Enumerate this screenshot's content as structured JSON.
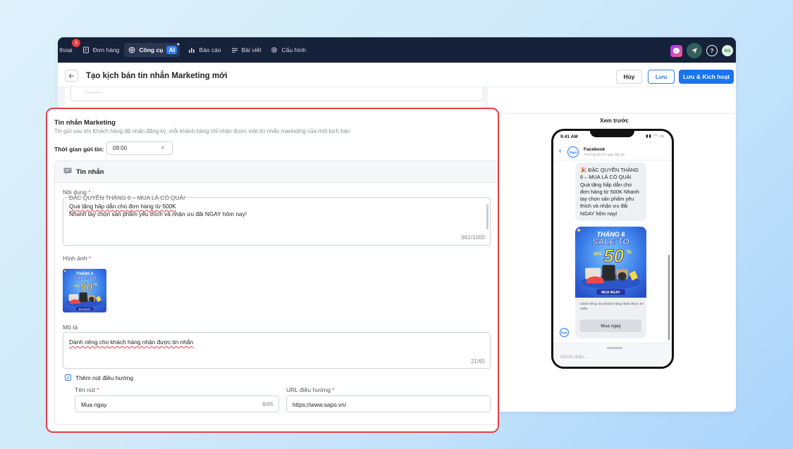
{
  "topbar": {
    "nav": [
      {
        "label": "i thoại",
        "icon": "chat-icon",
        "badge": "3"
      },
      {
        "label": "Đơn hàng",
        "icon": "order-icon"
      },
      {
        "label": "Công cụ",
        "icon": "tools-icon",
        "badge_label": "AI",
        "active": true
      },
      {
        "label": "Báo cáo",
        "icon": "chart-icon"
      },
      {
        "label": "Bài viết",
        "icon": "article-icon"
      },
      {
        "label": "Cấu hình",
        "icon": "gear-icon"
      }
    ],
    "avatar_initials": "NS"
  },
  "header": {
    "title": "Tạo kịch bản tin nhắn Marketing mới",
    "cancel_label": "Hủy",
    "save_label": "Lưu",
    "save_activate_label": "Lưu & Kích hoạt"
  },
  "top_card": {
    "dash": "------"
  },
  "section": {
    "title": "Tin nhắn Marketing",
    "description": "Tin gửi sau khi Khách hàng đã nhấn đăng ký, mỗi khách hàng chỉ nhận được một tin nhắn marketing của một kịch bản",
    "time_label": "Thời gian gửi tin:",
    "time_value": "09:00"
  },
  "message": {
    "header": "Tin nhắn",
    "content_label": "Nội dung",
    "content_lines": [
      "ĐẶC QUYỀN THÁNG 6 – MUA LÀ CÓ QUÀ!",
      "Quà tặng hấp dẫn cho đơn hàng từ 500K",
      "Nhanh tay chọn sản phẩm yêu thích và nhận ưu đãi NGAY hôm nay!"
    ],
    "content_counter": "861/1000",
    "image_label": "Hình ảnh",
    "desc_label": "Mô tả",
    "desc_value": "Dành riêng cho khách hàng nhận được tin nhắn",
    "desc_counter": "21/65",
    "nav_checkbox_label": "Thêm nút điều hướng",
    "button_name_label": "Tên nút",
    "button_name_value": "Mua ngay",
    "button_name_counter": "8/65",
    "url_label": "URL điều hướng",
    "url_value": "https://www.sapo.vn/"
  },
  "promo_image": {
    "line1": "THÁNG 6",
    "line2": "SALE TO",
    "prefix": "ĐẾN",
    "percent": "50",
    "cta": "MUA NGAY"
  },
  "preview": {
    "label": "Xem trước",
    "status_time": "9:41 AM",
    "page_name": "Facebook",
    "page_sub": "Thường trả lời ngay lập tức",
    "logo": "Sapo",
    "bubble_text": "🎉 ĐẶC QUYỀN THÁNG 6 – MUA LÀ CÓ QUÀ! Quà tặng hấp dẫn cho đơn hàng từ 500K Nhanh tay chọn sản phẩm yêu thích và nhận ưu đãi NGAY hôm nay!",
    "card_desc": "Dành riêng cho khách hàng nhận được tin nhắn",
    "card_button": "Mua ngay",
    "compose_placeholder": "Gửi tin nhắn ..."
  }
}
